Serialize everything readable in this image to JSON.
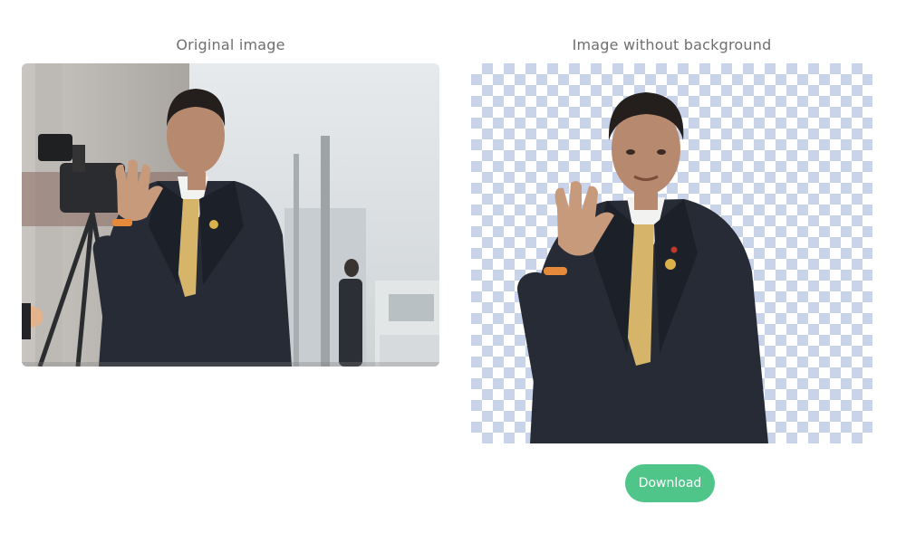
{
  "panels": {
    "original": {
      "title": "Original image"
    },
    "result": {
      "title": "Image without background"
    }
  },
  "actions": {
    "download_label": "Download"
  },
  "colors": {
    "accent": "#4fc58a",
    "checker": "#c9d3ea",
    "title_text": "#6f6f6f"
  }
}
